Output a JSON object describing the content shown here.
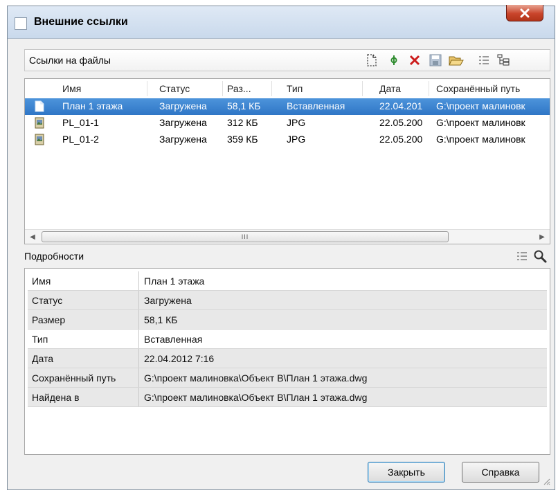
{
  "window": {
    "title": "Внешние ссылки"
  },
  "files_section": {
    "title": "Ссылки на файлы",
    "toolbar_icons": [
      "attach-icon",
      "reload-icon",
      "detach-icon",
      "save-icon",
      "open-folder-icon",
      "list-view-icon",
      "tree-view-icon"
    ],
    "columns": [
      "Имя",
      "Статус",
      "Раз...",
      "Тип",
      "Дата",
      "Сохранённый путь"
    ],
    "rows": [
      {
        "name": "План 1 этажа",
        "status": "Загружена",
        "size": "58,1 КБ",
        "type": "Вставленная",
        "date": "22.04.201",
        "path": "G:\\проект малиновк",
        "icon": "dwg-file-icon",
        "selected": true
      },
      {
        "name": "PL_01-1",
        "status": "Загружена",
        "size": "312 КБ",
        "type": "JPG",
        "date": "22.05.200",
        "path": "G:\\проект малиновк",
        "icon": "image-file-icon",
        "selected": false
      },
      {
        "name": "PL_01-2",
        "status": "Загружена",
        "size": "359 КБ",
        "type": "JPG",
        "date": "22.05.200",
        "path": "G:\\проект малиновк",
        "icon": "image-file-icon",
        "selected": false
      }
    ],
    "scrollbar_grip": "III"
  },
  "details_section": {
    "title": "Подробности",
    "rows": [
      {
        "label": "Имя",
        "value": "План 1 этажа"
      },
      {
        "label": "Статус",
        "value": "Загружена"
      },
      {
        "label": "Размер",
        "value": "58,1 КБ"
      },
      {
        "label": "Тип",
        "value": "Вставленная"
      },
      {
        "label": "Дата",
        "value": "22.04.2012 7:16"
      },
      {
        "label": "Сохранённый путь",
        "value": "G:\\проект малиновка\\Объект В\\План 1 этажа.dwg"
      },
      {
        "label": "Найдена в",
        "value": "G:\\проект малиновка\\Объект В\\План 1 этажа.dwg"
      }
    ]
  },
  "buttons": {
    "close": "Закрыть",
    "help": "Справка"
  },
  "colors": {
    "selection": "#3a80cf",
    "close_button": "#c9452b",
    "alt_row": "#e8e8e8"
  }
}
